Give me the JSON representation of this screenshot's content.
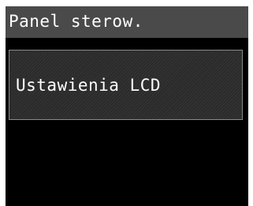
{
  "header": {
    "title": "Panel sterow."
  },
  "menu": {
    "items": [
      {
        "label": "Ustawienia LCD"
      }
    ]
  },
  "colors": {
    "header_background": "#4a4a4a",
    "screen_background": "#000000",
    "item_border": "#8a8a8a",
    "text": "#ffffff"
  }
}
